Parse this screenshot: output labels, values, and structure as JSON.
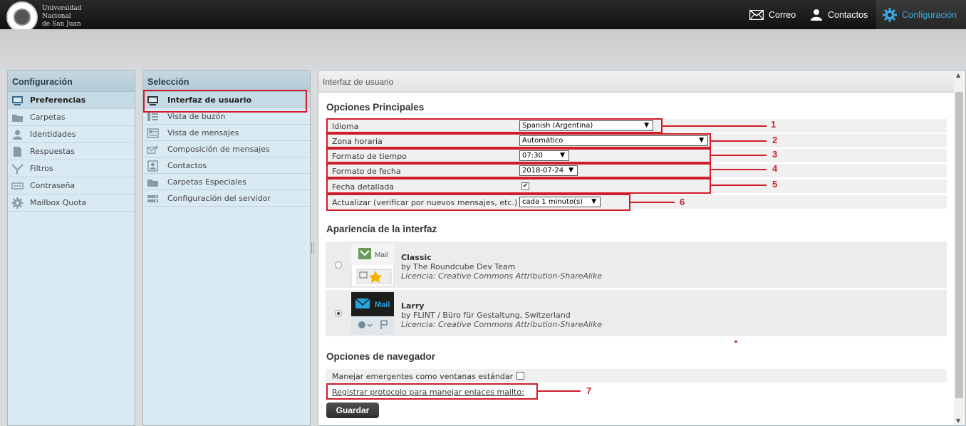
{
  "header": {
    "logo_text": [
      "Universidad",
      "Nacional",
      "de San Juan"
    ],
    "nav": [
      {
        "label": "Correo",
        "icon": "mail-icon"
      },
      {
        "label": "Contactos",
        "icon": "user-icon"
      },
      {
        "label": "Configuración",
        "icon": "gear-icon",
        "active": true
      }
    ]
  },
  "config_panel": {
    "title": "Configuración",
    "items": [
      {
        "label": "Preferencias",
        "icon": "monitor-icon",
        "active": true
      },
      {
        "label": "Carpetas",
        "icon": "folder-icon"
      },
      {
        "label": "Identidades",
        "icon": "person-icon"
      },
      {
        "label": "Respuestas",
        "icon": "document-icon"
      },
      {
        "label": "Filtros",
        "icon": "filter-icon"
      },
      {
        "label": "Contraseña",
        "icon": "password-icon"
      },
      {
        "label": "Mailbox Quota",
        "icon": "gear-icon"
      }
    ]
  },
  "selection_panel": {
    "title": "Selección",
    "items": [
      {
        "label": "Interfaz de usuario",
        "icon": "monitor-icon",
        "active": true
      },
      {
        "label": "Vista de buzón",
        "icon": "list-icon"
      },
      {
        "label": "Vista de mensajes",
        "icon": "message-icon"
      },
      {
        "label": "Composición de mensajes",
        "icon": "compose-icon"
      },
      {
        "label": "Contactos",
        "icon": "contacts-icon"
      },
      {
        "label": "Carpetas Especiales",
        "icon": "folder-icon"
      },
      {
        "label": "Configuración del servidor",
        "icon": "server-icon"
      }
    ]
  },
  "main": {
    "header": "Interfaz de usuario",
    "sections": {
      "main_options": "Opciones Principales",
      "appearance": "Apariencia de la interfaz",
      "browser": "Opciones de navegador"
    },
    "options": {
      "language": {
        "label": "Idioma",
        "value": "Spanish (Argentina)"
      },
      "timezone": {
        "label": "Zona horaria",
        "value": "Automático"
      },
      "time_format": {
        "label": "Formato de tiempo",
        "value": "07:30"
      },
      "date_format": {
        "label": "Formato de fecha",
        "value": "2018-07-24"
      },
      "pretty_date": {
        "label": "Fecha detallada",
        "checked": true
      },
      "refresh": {
        "label": "Actualizar (verificar por nuevos mensajes, etc.)",
        "value": "cada 1 minuto(s)"
      }
    },
    "skins": [
      {
        "name": "Classic",
        "author": "by The Roundcube Dev Team",
        "license": "Licencia: Creative Commons Attribution-ShareAlike",
        "thumb_text": "Mail",
        "selected": false
      },
      {
        "name": "Larry",
        "author": "by FLINT / Büro für Gestaltung, Switzerland",
        "license": "Licencia: Creative Commons Attribution-ShareAlike",
        "thumb_text": "Mail",
        "selected": true
      }
    ],
    "browser_options": {
      "popups": {
        "label": "Manejar emergentes como ventanas estándar",
        "checked": false
      },
      "mailto_link": "Registrar protocolo para manejar enlaces mailto:"
    },
    "save_label": "Guardar"
  },
  "annotations": {
    "color": "#d11c2a",
    "numbers": [
      "1",
      "2",
      "3",
      "4",
      "5",
      "6",
      "7"
    ]
  }
}
